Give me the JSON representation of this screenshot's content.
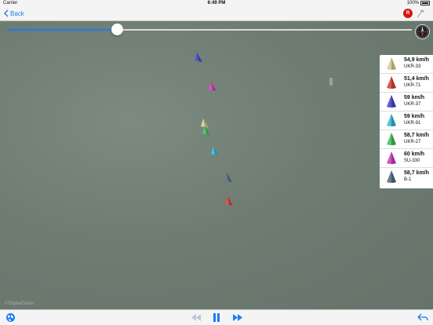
{
  "status_bar": {
    "carrier": "Carrier",
    "time": "6:49 PM",
    "battery": "100%"
  },
  "nav": {
    "back_label": "Back",
    "record_label": "R"
  },
  "map": {
    "watermark": "©DigitalGlobe",
    "progress": 0.27
  },
  "legend": {
    "rows": [
      {
        "speed": "54,9 km/h",
        "name": "UKR-33",
        "color": "#d8d3a0"
      },
      {
        "speed": "51,4 km/h",
        "name": "UKR-71",
        "color": "#e0554c"
      },
      {
        "speed": "59 km/h",
        "name": "UKR-37",
        "color": "#5a57d8"
      },
      {
        "speed": "59 km/h",
        "name": "UKR-91",
        "color": "#48c3d8"
      },
      {
        "speed": "58,7 km/h",
        "name": "UKR-27",
        "color": "#54c76a"
      },
      {
        "speed": "60 km/h",
        "name": "SU-330",
        "color": "#d653c4"
      },
      {
        "speed": "58,7 km/h",
        "name": "B-1",
        "color": "#6c7c8c"
      }
    ]
  },
  "boats": [
    {
      "color": "#5a57d8",
      "icon": "boat-icon"
    },
    {
      "color": "#d653c4",
      "icon": "boat-icon"
    },
    {
      "color": "#d8d3a0",
      "icon": "boat-icon"
    },
    {
      "color": "#54c76a",
      "icon": "boat-icon"
    },
    {
      "color": "#48c3d8",
      "icon": "boat-icon"
    },
    {
      "color": "#6c7c8c",
      "icon": "boat-icon"
    },
    {
      "color": "#e0554c",
      "icon": "boat-icon"
    }
  ],
  "toolbar": {
    "icons": [
      "globe-icon",
      "rewind-icon",
      "pause-icon",
      "fast-forward-icon",
      "share-icon"
    ]
  }
}
